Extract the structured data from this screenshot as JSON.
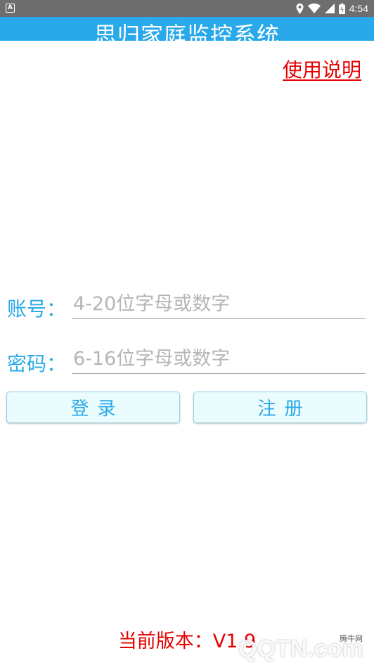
{
  "statusbar": {
    "notification_icon": "A",
    "time": "4:54",
    "icons": [
      "location-icon",
      "wifi-icon",
      "signal-icon",
      "battery-icon"
    ]
  },
  "app": {
    "title": "思归家庭监控系统",
    "help_link": "使用说明"
  },
  "login_form": {
    "account_label": "账号：",
    "account_placeholder": "4-20位字母或数字",
    "password_label": "密码：",
    "password_placeholder": "6-16位字母或数字",
    "login_button": "登录",
    "register_button": "注册"
  },
  "footer": {
    "version_text": "当前版本：V1.9"
  },
  "watermark": {
    "logo_text": "QQTN.com",
    "site_text": "腾牛网"
  },
  "colors": {
    "accent": "#29a9ea",
    "link_red": "#e60000",
    "button_bg": "#eafcfd",
    "statusbar": "#6e6e6e"
  }
}
